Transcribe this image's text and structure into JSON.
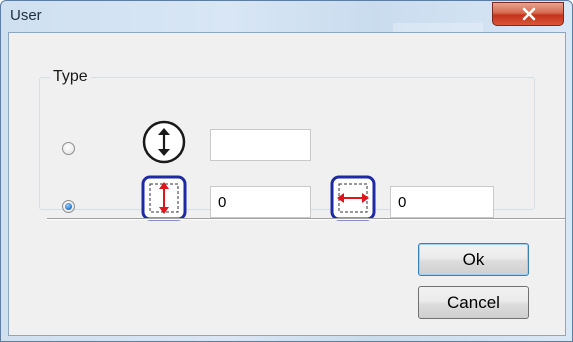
{
  "window": {
    "title": "User",
    "close_icon": "close-icon"
  },
  "group": {
    "label": "Type",
    "options": [
      {
        "selected": false,
        "icon": "circle-vertical-arrows-icon",
        "value": ""
      },
      {
        "selected": true,
        "icon": "vertical-resize-icon",
        "value": "0",
        "second_icon": "horizontal-resize-icon",
        "second_value": "0"
      }
    ]
  },
  "buttons": {
    "ok": "Ok",
    "cancel": "Cancel"
  },
  "colors": {
    "icon_frame": "#1d2aa3",
    "arrow_red": "#e0151b",
    "title_bg": "#cfe0f1"
  }
}
